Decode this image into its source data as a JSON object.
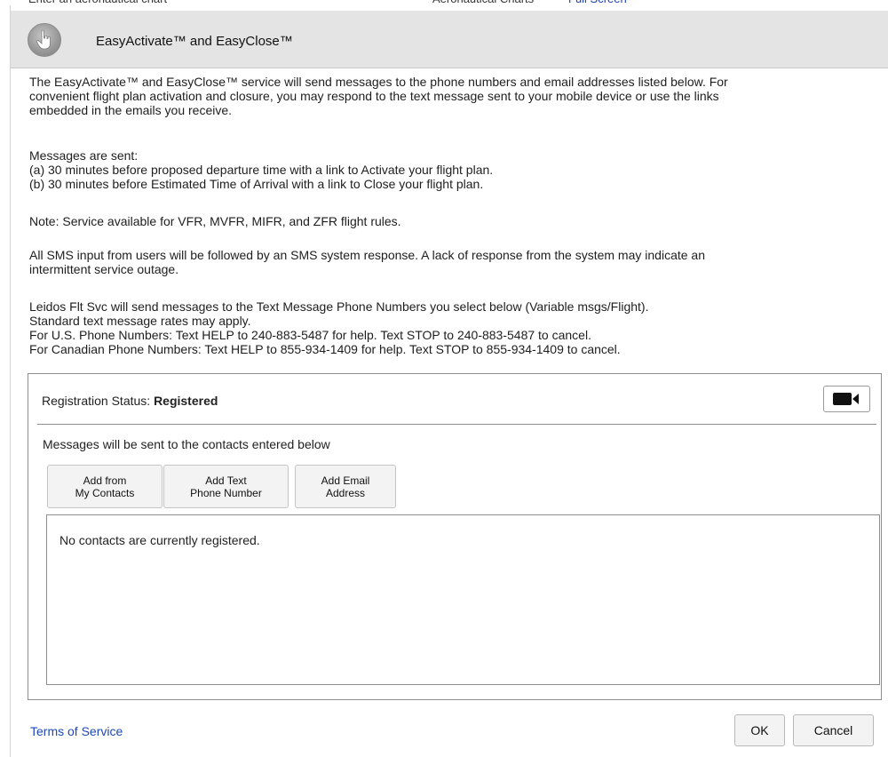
{
  "dialog": {
    "title": "EasyActivate™ and EasyClose™",
    "header_icon": "pointer-hand-icon",
    "intro_lines": [
      "The EasyActivate™ and EasyClose™ service will send messages to the phone numbers and email addresses listed below. For",
      "convenient flight plan activation and closure, you may respond to the text message sent to your mobile device or use the links",
      "embedded in the emails you receive."
    ],
    "messages_lines": [
      "Messages are sent:",
      "(a) 30 minutes before proposed departure time with a link to Activate your flight plan.",
      "(b) 30 minutes before Estimated Time of Arrival with a link to Close your flight plan."
    ],
    "note": "Note: Service available for VFR, MVFR, MIFR, and ZFR flight rules.",
    "sms_lines": [
      "All SMS input from users will be followed by an SMS system response. A lack of response from the system may indicate an",
      "intermittent service outage."
    ],
    "leidos_lines": [
      "Leidos Flt Svc will send messages to the Text Message Phone Numbers you select below (Variable msgs/Flight).",
      "Standard text message rates may apply.",
      "For U.S. Phone Numbers: Text HELP to 240-883-5487 for help. Text STOP to 240-883-5487 to cancel.",
      "For Canadian Phone Numbers: Text HELP to 855-934-1409 for help. Text STOP to 855-934-1409 to cancel."
    ]
  },
  "registration": {
    "status_label": "Registration Status: ",
    "status_value": "Registered",
    "video_icon": "video-camera-icon",
    "messages_line": "Messages will be sent to the contacts entered below",
    "buttons": {
      "add_contacts": [
        "Add from",
        "My Contacts"
      ],
      "add_phone": [
        "Add Text",
        "Phone Number"
      ],
      "add_email": [
        "Add Email",
        "Address"
      ]
    },
    "empty_text": "No contacts are currently registered."
  },
  "footer": {
    "terms": "Terms of Service",
    "ok": "OK",
    "cancel": "Cancel"
  },
  "colors": {
    "header_bg": "#e4e4e4",
    "link": "#1e48b8",
    "border": "#8e8e8e"
  }
}
